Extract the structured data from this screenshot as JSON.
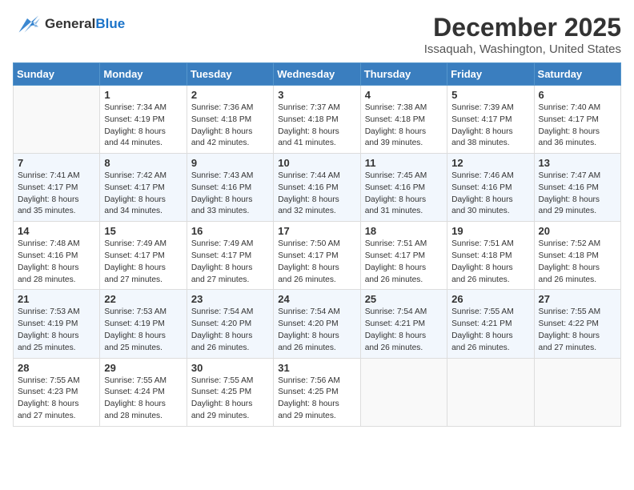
{
  "header": {
    "logo_line1": "General",
    "logo_line2": "Blue",
    "month": "December 2025",
    "location": "Issaquah, Washington, United States"
  },
  "days_of_week": [
    "Sunday",
    "Monday",
    "Tuesday",
    "Wednesday",
    "Thursday",
    "Friday",
    "Saturday"
  ],
  "weeks": [
    [
      {
        "num": "",
        "info": ""
      },
      {
        "num": "1",
        "info": "Sunrise: 7:34 AM\nSunset: 4:19 PM\nDaylight: 8 hours\nand 44 minutes."
      },
      {
        "num": "2",
        "info": "Sunrise: 7:36 AM\nSunset: 4:18 PM\nDaylight: 8 hours\nand 42 minutes."
      },
      {
        "num": "3",
        "info": "Sunrise: 7:37 AM\nSunset: 4:18 PM\nDaylight: 8 hours\nand 41 minutes."
      },
      {
        "num": "4",
        "info": "Sunrise: 7:38 AM\nSunset: 4:18 PM\nDaylight: 8 hours\nand 39 minutes."
      },
      {
        "num": "5",
        "info": "Sunrise: 7:39 AM\nSunset: 4:17 PM\nDaylight: 8 hours\nand 38 minutes."
      },
      {
        "num": "6",
        "info": "Sunrise: 7:40 AM\nSunset: 4:17 PM\nDaylight: 8 hours\nand 36 minutes."
      }
    ],
    [
      {
        "num": "7",
        "info": "Sunrise: 7:41 AM\nSunset: 4:17 PM\nDaylight: 8 hours\nand 35 minutes."
      },
      {
        "num": "8",
        "info": "Sunrise: 7:42 AM\nSunset: 4:17 PM\nDaylight: 8 hours\nand 34 minutes."
      },
      {
        "num": "9",
        "info": "Sunrise: 7:43 AM\nSunset: 4:16 PM\nDaylight: 8 hours\nand 33 minutes."
      },
      {
        "num": "10",
        "info": "Sunrise: 7:44 AM\nSunset: 4:16 PM\nDaylight: 8 hours\nand 32 minutes."
      },
      {
        "num": "11",
        "info": "Sunrise: 7:45 AM\nSunset: 4:16 PM\nDaylight: 8 hours\nand 31 minutes."
      },
      {
        "num": "12",
        "info": "Sunrise: 7:46 AM\nSunset: 4:16 PM\nDaylight: 8 hours\nand 30 minutes."
      },
      {
        "num": "13",
        "info": "Sunrise: 7:47 AM\nSunset: 4:16 PM\nDaylight: 8 hours\nand 29 minutes."
      }
    ],
    [
      {
        "num": "14",
        "info": "Sunrise: 7:48 AM\nSunset: 4:16 PM\nDaylight: 8 hours\nand 28 minutes."
      },
      {
        "num": "15",
        "info": "Sunrise: 7:49 AM\nSunset: 4:17 PM\nDaylight: 8 hours\nand 27 minutes."
      },
      {
        "num": "16",
        "info": "Sunrise: 7:49 AM\nSunset: 4:17 PM\nDaylight: 8 hours\nand 27 minutes."
      },
      {
        "num": "17",
        "info": "Sunrise: 7:50 AM\nSunset: 4:17 PM\nDaylight: 8 hours\nand 26 minutes."
      },
      {
        "num": "18",
        "info": "Sunrise: 7:51 AM\nSunset: 4:17 PM\nDaylight: 8 hours\nand 26 minutes."
      },
      {
        "num": "19",
        "info": "Sunrise: 7:51 AM\nSunset: 4:18 PM\nDaylight: 8 hours\nand 26 minutes."
      },
      {
        "num": "20",
        "info": "Sunrise: 7:52 AM\nSunset: 4:18 PM\nDaylight: 8 hours\nand 26 minutes."
      }
    ],
    [
      {
        "num": "21",
        "info": "Sunrise: 7:53 AM\nSunset: 4:19 PM\nDaylight: 8 hours\nand 25 minutes."
      },
      {
        "num": "22",
        "info": "Sunrise: 7:53 AM\nSunset: 4:19 PM\nDaylight: 8 hours\nand 25 minutes."
      },
      {
        "num": "23",
        "info": "Sunrise: 7:54 AM\nSunset: 4:20 PM\nDaylight: 8 hours\nand 26 minutes."
      },
      {
        "num": "24",
        "info": "Sunrise: 7:54 AM\nSunset: 4:20 PM\nDaylight: 8 hours\nand 26 minutes."
      },
      {
        "num": "25",
        "info": "Sunrise: 7:54 AM\nSunset: 4:21 PM\nDaylight: 8 hours\nand 26 minutes."
      },
      {
        "num": "26",
        "info": "Sunrise: 7:55 AM\nSunset: 4:21 PM\nDaylight: 8 hours\nand 26 minutes."
      },
      {
        "num": "27",
        "info": "Sunrise: 7:55 AM\nSunset: 4:22 PM\nDaylight: 8 hours\nand 27 minutes."
      }
    ],
    [
      {
        "num": "28",
        "info": "Sunrise: 7:55 AM\nSunset: 4:23 PM\nDaylight: 8 hours\nand 27 minutes."
      },
      {
        "num": "29",
        "info": "Sunrise: 7:55 AM\nSunset: 4:24 PM\nDaylight: 8 hours\nand 28 minutes."
      },
      {
        "num": "30",
        "info": "Sunrise: 7:55 AM\nSunset: 4:25 PM\nDaylight: 8 hours\nand 29 minutes."
      },
      {
        "num": "31",
        "info": "Sunrise: 7:56 AM\nSunset: 4:25 PM\nDaylight: 8 hours\nand 29 minutes."
      },
      {
        "num": "",
        "info": ""
      },
      {
        "num": "",
        "info": ""
      },
      {
        "num": "",
        "info": ""
      }
    ]
  ]
}
